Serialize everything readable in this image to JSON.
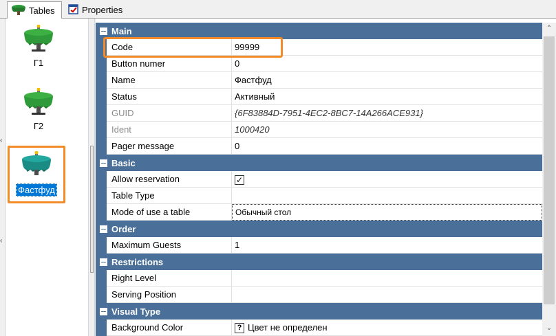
{
  "tabs": [
    {
      "label": "Tables",
      "icon": "table-icon",
      "active": true
    },
    {
      "label": "Properties",
      "icon": "properties-icon",
      "active": false
    }
  ],
  "tables": [
    {
      "label": "Г1",
      "selected": false
    },
    {
      "label": "Г2",
      "selected": false
    },
    {
      "label": "Фастфуд",
      "selected": true
    }
  ],
  "categories": {
    "main": "Main",
    "basic": "Basic",
    "order": "Order",
    "restrictions": "Restrictions",
    "visual": "Visual Type"
  },
  "props": {
    "code": {
      "name": "Code",
      "value": "99999"
    },
    "button_number": {
      "name": "Button numer",
      "value": "0"
    },
    "name": {
      "name": "Name",
      "value": "Фастфуд"
    },
    "status": {
      "name": "Status",
      "value": "Активный"
    },
    "guid": {
      "name": "GUID",
      "value": "{6F83884D-7951-4EC2-8BC7-14A266ACE931}"
    },
    "ident": {
      "name": "Ident",
      "value": "1000420"
    },
    "pager": {
      "name": "Pager message",
      "value": "0"
    },
    "allow_reservation": {
      "name": "Allow reservation",
      "value": true
    },
    "table_type": {
      "name": "Table Type",
      "value": ""
    },
    "mode": {
      "name": "Mode of use a table",
      "value": "Обычный стол"
    },
    "max_guests": {
      "name": "Maximum Guests",
      "value": "1"
    },
    "right_level": {
      "name": "Right Level",
      "value": ""
    },
    "serving_position": {
      "name": "Serving Position",
      "value": ""
    },
    "bg_color": {
      "name": "Background Color",
      "value": "Цвет не определен",
      "icon": "?"
    }
  },
  "colors": {
    "category_bg": "#4a6f98",
    "highlight": "#f28c28",
    "selection": "#0078d7",
    "table_green": "#2e9a3a",
    "table_teal": "#1a8c84"
  }
}
